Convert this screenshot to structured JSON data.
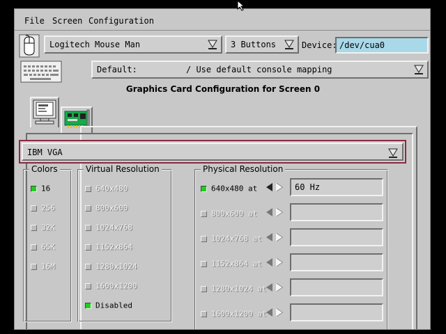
{
  "menu": {
    "file": "File",
    "screen": "Screen",
    "configuration": "Configuration"
  },
  "mouse": {
    "model": "Logitech Mouse Man",
    "buttons": "3 Buttons",
    "device_label": "Device:",
    "device_value": "/dev/cua0"
  },
  "keyboard": {
    "mapping_name": "Default:",
    "mapping_desc": "/ Use default console mapping"
  },
  "graphics": {
    "title": "Graphics Card Configuration for Screen 0",
    "card": "IBM VGA"
  },
  "colors": {
    "title": "Colors",
    "options": [
      "16",
      "256",
      "32K",
      "65K",
      "16M"
    ],
    "selected": "16"
  },
  "virtual": {
    "title": "Virtual Resolution",
    "options": [
      "640x480",
      "800x600",
      "1024x768",
      "1152x864",
      "1280x1024",
      "1600x1200"
    ],
    "disabled_label": "Disabled",
    "selected": "Disabled"
  },
  "physical": {
    "title": "Physical Resolution",
    "rows": [
      {
        "label": "640x480 at",
        "rate": "60 Hz",
        "enabled": true
      },
      {
        "label": "800x600 at",
        "rate": "",
        "enabled": false
      },
      {
        "label": "1024x768 at",
        "rate": "",
        "enabled": false
      },
      {
        "label": "1152x864 at",
        "rate": "",
        "enabled": false
      },
      {
        "label": "1280x1024 at",
        "rate": "",
        "enabled": false
      },
      {
        "label": "1600x1200 at",
        "rate": "",
        "enabled": false
      }
    ]
  },
  "colors_map": {
    "window_bg": "#c8c8c8",
    "entry_bg": "#a9d8e8",
    "accent_border": "#8a2a3e",
    "radio_on": "#1fcf1f"
  }
}
